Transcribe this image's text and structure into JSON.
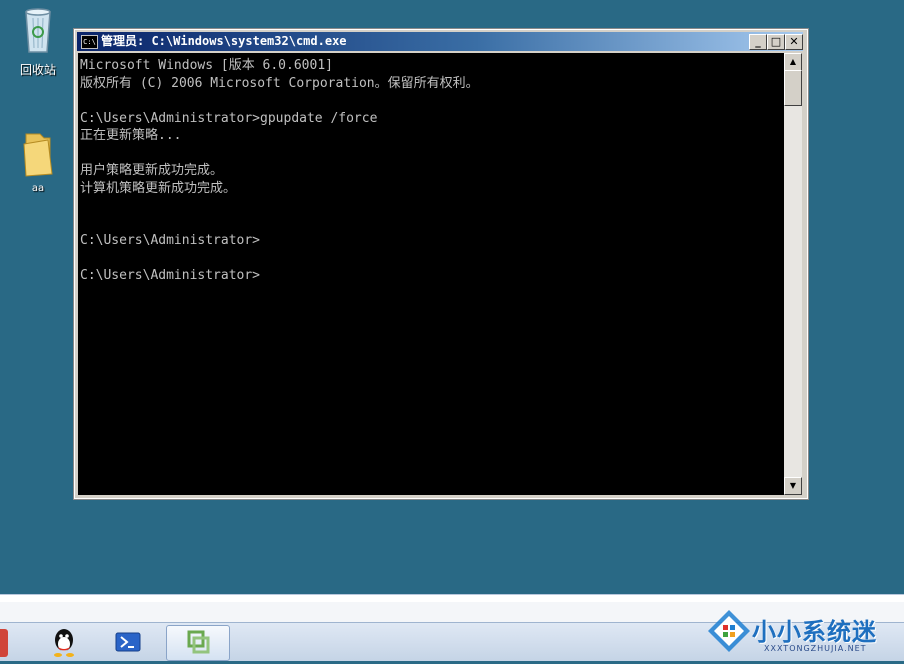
{
  "desktop": {
    "icons": [
      {
        "label": "回收站",
        "icon": "recycle-bin-icon"
      },
      {
        "label": "aa",
        "icon": "folder-icon"
      }
    ]
  },
  "window": {
    "title": "管理员: C:\\Windows\\system32\\cmd.exe",
    "buttons": {
      "minimize": "_",
      "restore": "□",
      "close": "✕"
    },
    "icon_text": "C:\\"
  },
  "console": {
    "lines": [
      "Microsoft Windows [版本 6.0.6001]",
      "版权所有 (C) 2006 Microsoft Corporation。保留所有权利。",
      "",
      "C:\\Users\\Administrator>gpupdate /force",
      "正在更新策略...",
      "",
      "用户策略更新成功完成。",
      "计算机策略更新成功完成。",
      "",
      "",
      "C:\\Users\\Administrator>",
      "",
      "C:\\Users\\Administrator>"
    ]
  },
  "taskbar": {
    "items": [
      {
        "name": "qq-icon"
      },
      {
        "name": "powershell-icon"
      },
      {
        "name": "vmware-icon"
      }
    ]
  },
  "watermark": {
    "text": "小小系统迷",
    "sub": "XXXTONGZHUJIA.NET"
  },
  "colors": {
    "desktop": "#296985",
    "console_bg": "#000000",
    "console_fg": "#c0c0c0"
  }
}
